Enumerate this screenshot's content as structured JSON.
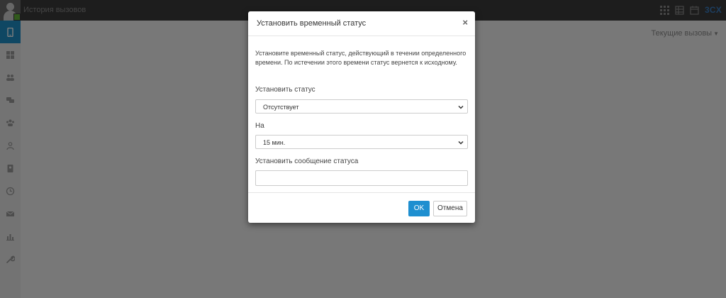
{
  "app": {
    "page_title": "История вызовов",
    "brand_logo": "3CX",
    "brand_color": "#1e8fc6"
  },
  "top_tools": [
    {
      "icon": "dialpad-icon"
    },
    {
      "icon": "grid-icon"
    },
    {
      "icon": "calendar-icon"
    }
  ],
  "sidebar": {
    "items": [
      {
        "icon": "phone-icon",
        "active": true
      },
      {
        "icon": "windows-icon"
      },
      {
        "icon": "users-icon"
      },
      {
        "icon": "chat-icon"
      },
      {
        "icon": "group-icon"
      },
      {
        "icon": "user-switch-icon"
      },
      {
        "icon": "contacts-icon"
      },
      {
        "icon": "history-icon"
      },
      {
        "icon": "mail-icon"
      },
      {
        "icon": "chart-icon"
      },
      {
        "icon": "wrench-icon"
      }
    ]
  },
  "content": {
    "dropdown_label": "Текущие вызовы"
  },
  "modal": {
    "title": "Установить временный статус",
    "close_label": "×",
    "description": "Установите временный статус, действующий в течении определенного времени. По истечении этого времени статус вернется к исходному.",
    "status_label": "Установить статус",
    "status_value": "Отсутствует",
    "duration_label": "На",
    "duration_value": "15 мин.",
    "message_label": "Установить сообщение статуса",
    "message_value": "",
    "ok_label": "OK",
    "cancel_label": "Отмена"
  }
}
